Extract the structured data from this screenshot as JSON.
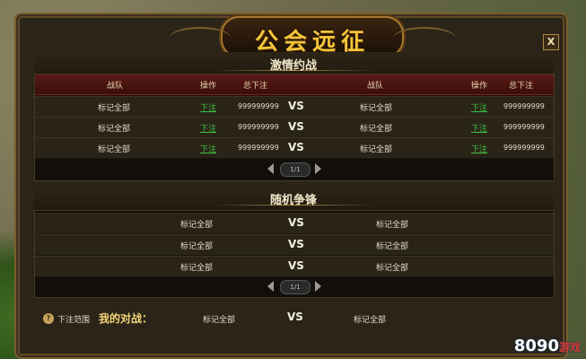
{
  "window": {
    "title": "公会远征",
    "close_label": "X"
  },
  "sections": {
    "challenge": {
      "title": "激情约战",
      "headers": {
        "team": "战队",
        "op": "操作",
        "total": "总下注"
      },
      "rows": [
        {
          "left": "标记全部",
          "left_op": "下注",
          "left_total": "999999999",
          "vs": "VS",
          "right": "标记全部",
          "right_op": "下注",
          "right_total": "999999999"
        },
        {
          "left": "标记全部",
          "left_op": "下注",
          "left_total": "999999999",
          "vs": "VS",
          "right": "标记全部",
          "right_op": "下注",
          "right_total": "999999999"
        },
        {
          "left": "标记全部",
          "left_op": "下注",
          "left_total": "999999999",
          "vs": "VS",
          "right": "标记全部",
          "right_op": "下注",
          "right_total": "999999999"
        }
      ],
      "page": "1/1"
    },
    "random": {
      "title": "随机争锋",
      "rows": [
        {
          "left": "标记全部",
          "vs": "VS",
          "right": "标记全部"
        },
        {
          "left": "标记全部",
          "vs": "VS",
          "right": "标记全部"
        },
        {
          "left": "标记全部",
          "vs": "VS",
          "right": "标记全部"
        }
      ],
      "page": "1/1"
    }
  },
  "bottom": {
    "help_icon": "?",
    "range_label": "下注范围",
    "my_battle_label": "我的对战：",
    "left": "标记全部",
    "vs": "VS",
    "right": "标记全部"
  },
  "watermark": {
    "text": "8090",
    "suffix": "游戏"
  },
  "colors": {
    "title": "#f5c53a",
    "bet_link": "#3fbf3f",
    "header_bg": "#5a1a15"
  }
}
